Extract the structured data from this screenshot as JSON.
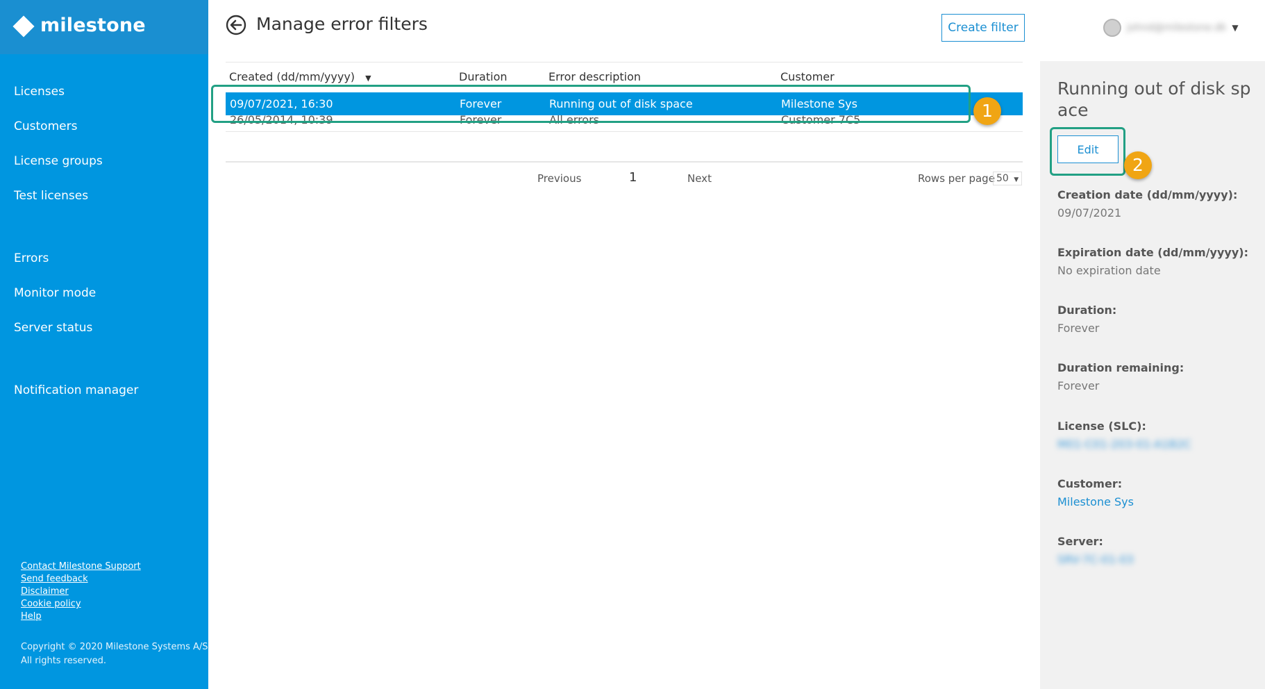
{
  "sidebar": {
    "brand": "milestone",
    "nav": [
      "Licenses",
      "Customers",
      "License groups",
      "Test licenses",
      "Errors",
      "Monitor mode",
      "Server status",
      "Notification manager"
    ],
    "footer_links": [
      "Contact Milestone Support",
      "Send feedback",
      "Disclaimer",
      "Cookie policy",
      "Help"
    ],
    "copyright_line1": "Copyright © 2020 Milestone Systems A/S",
    "copyright_line2": "All rights reserved."
  },
  "header": {
    "title": "Manage error filters",
    "create_button": "Create filter",
    "user_name": "johnd@milestone.dk"
  },
  "table": {
    "columns": [
      "Created (dd/mm/yyyy)",
      "Duration",
      "Error description",
      "Customer"
    ],
    "rows": [
      {
        "created": "09/07/2021, 16:30",
        "duration": "Forever",
        "description": "Running out of disk space",
        "customer": "Milestone Sys"
      },
      {
        "created": "26/05/2014, 10:39",
        "duration": "Forever",
        "description": "All errors",
        "customer": "Customer 7C5"
      }
    ]
  },
  "pager": {
    "previous": "Previous",
    "page": "1",
    "next": "Next",
    "rows_label": "Rows per page",
    "rows_value": "50"
  },
  "detail": {
    "title": "Running out of disk space",
    "edit_button": "Edit",
    "creation_label": "Creation date (dd/mm/yyyy):",
    "creation_value": "09/07/2021",
    "expiration_label": "Expiration date (dd/mm/yyyy):",
    "expiration_value": "No expiration date",
    "duration_label": "Duration:",
    "duration_value": "Forever",
    "remaining_label": "Duration remaining:",
    "remaining_value": "Forever",
    "license_label": "License (SLC):",
    "license_value": "M01-C01-203-01-A1B2C",
    "customer_label": "Customer:",
    "customer_value": "Milestone Sys",
    "server_label": "Server:",
    "server_value": "SRV-7C-01-03"
  },
  "annotations": {
    "badge1": "1",
    "badge2": "2",
    "color": "#22a084",
    "badge_color": "#f0a514"
  },
  "colors": {
    "brand_blue": "#0096e0",
    "accent": "#1b8fd2"
  }
}
